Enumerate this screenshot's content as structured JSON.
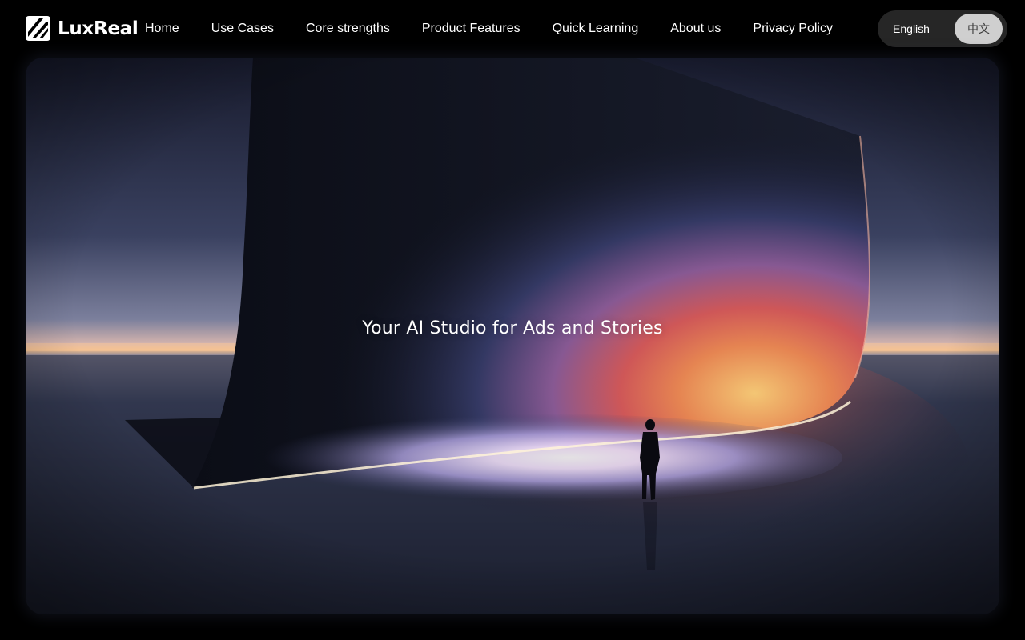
{
  "brand": {
    "name": "LuxReal",
    "logo_icon": "luxreal-logo-icon"
  },
  "nav": {
    "items": [
      {
        "label": "Home"
      },
      {
        "label": "Use Cases"
      },
      {
        "label": "Core strengths"
      },
      {
        "label": "Product Features"
      },
      {
        "label": "Quick Learning"
      },
      {
        "label": "About us"
      },
      {
        "label": "Privacy Policy"
      }
    ]
  },
  "language": {
    "english": "English",
    "chinese": "中文",
    "selected": "中文"
  },
  "hero": {
    "title": "Your AI Studio for Ads and Stories"
  },
  "colors": {
    "background": "#000000",
    "accent_glow": "#e25a50",
    "toggle_active": "#cfcfcf"
  }
}
